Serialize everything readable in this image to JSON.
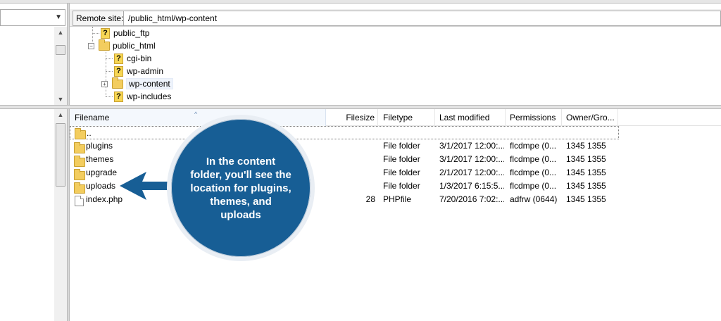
{
  "remote": {
    "label": "Remote site:",
    "path": "/public_html/wp-content"
  },
  "tree": {
    "items": [
      {
        "label": "public_ftp",
        "icon": "question-folder-icon"
      },
      {
        "label": "public_html",
        "icon": "folder-icon"
      },
      {
        "label": "cgi-bin",
        "icon": "question-folder-icon"
      },
      {
        "label": "wp-admin",
        "icon": "question-folder-icon"
      },
      {
        "label": "wp-content",
        "icon": "folder-icon"
      },
      {
        "label": "wp-includes",
        "icon": "question-folder-icon"
      }
    ],
    "expander_minus": "−",
    "expander_plus": "+"
  },
  "list": {
    "headers": {
      "filename": "Filename",
      "filesize": "Filesize",
      "filetype": "Filetype",
      "modified": "Last modified",
      "permissions": "Permissions",
      "owner": "Owner/Gro..."
    },
    "rows": [
      {
        "name": "..",
        "size": "",
        "type": "",
        "modified": "",
        "perms": "",
        "owner": "",
        "icon": "folder-icon"
      },
      {
        "name": "plugins",
        "size": "",
        "type": "File folder",
        "modified": "3/1/2017 12:00:...",
        "perms": "flcdmpe (0...",
        "owner": "1345 1355",
        "icon": "folder-icon"
      },
      {
        "name": "themes",
        "size": "",
        "type": "File folder",
        "modified": "3/1/2017 12:00:...",
        "perms": "flcdmpe (0...",
        "owner": "1345 1355",
        "icon": "folder-icon"
      },
      {
        "name": "upgrade",
        "size": "",
        "type": "File folder",
        "modified": "2/1/2017 12:00:...",
        "perms": "flcdmpe (0...",
        "owner": "1345 1355",
        "icon": "folder-icon"
      },
      {
        "name": "uploads",
        "size": "",
        "type": "File folder",
        "modified": "1/3/2017 6:15:5...",
        "perms": "flcdmpe (0...",
        "owner": "1345 1355",
        "icon": "folder-icon"
      },
      {
        "name": "index.php",
        "size": "28",
        "type": "PHPfile",
        "modified": "7/20/2016 7:02:...",
        "perms": "adfrw (0644)",
        "owner": "1345 1355",
        "icon": "file-icon"
      }
    ]
  },
  "callout": {
    "text": "In the content folder, you'll see the location for plugins, themes, and uploads",
    "color": "#175e95"
  },
  "icons": {
    "combo_arrow": "▼",
    "scroll_up": "▲",
    "scroll_down": "▼",
    "sort_caret": "^",
    "question_mark": "?"
  }
}
